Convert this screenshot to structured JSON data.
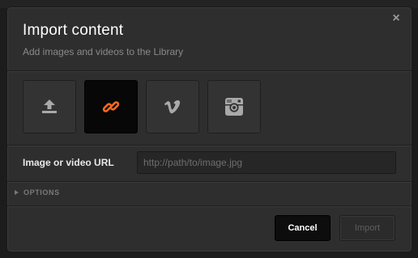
{
  "dialog": {
    "title": "Import content",
    "subtitle": "Add images and videos to the Library",
    "close_label": "×"
  },
  "sources": [
    {
      "name": "upload",
      "icon": "upload-icon",
      "active": false
    },
    {
      "name": "link",
      "icon": "link-icon",
      "active": true
    },
    {
      "name": "vimeo",
      "icon": "vimeo-icon",
      "active": false
    },
    {
      "name": "instagram",
      "icon": "instagram-icon",
      "active": false
    }
  ],
  "url_field": {
    "label": "Image or video URL",
    "placeholder": "http://path/to/image.jpg",
    "value": ""
  },
  "options": {
    "label": "OPTIONS",
    "expanded": false
  },
  "footer": {
    "cancel_label": "Cancel",
    "import_label": "Import",
    "import_enabled": false
  },
  "colors": {
    "accent": "#f26a21",
    "dialog_bg": "#2e2e2e",
    "active_tile_bg": "#070707",
    "icon_gray": "#a9a9a9"
  }
}
